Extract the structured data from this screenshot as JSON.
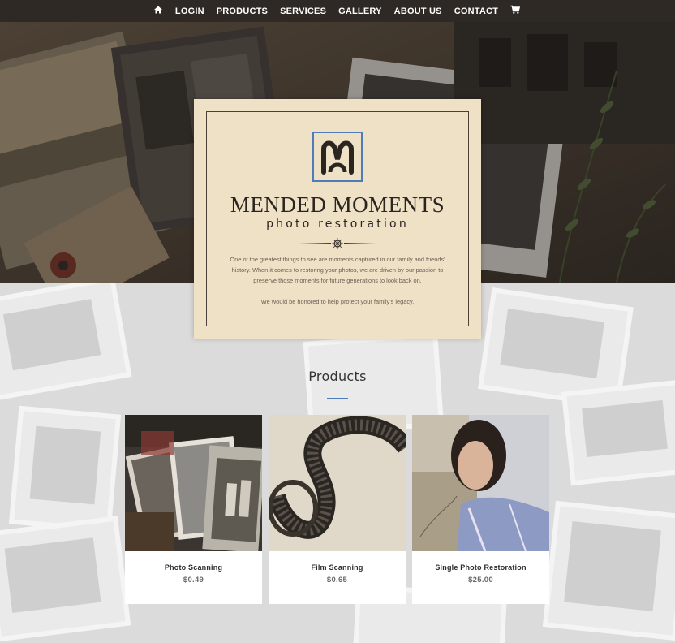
{
  "nav": {
    "home_icon": "home-icon",
    "items": [
      {
        "label": "LOGIN"
      },
      {
        "label": "PRODUCTS"
      },
      {
        "label": "SERVICES"
      },
      {
        "label": "GALLERY"
      },
      {
        "label": "ABOUT US"
      },
      {
        "label": "CONTACT"
      }
    ],
    "cart_icon": "cart-icon"
  },
  "hero_card": {
    "logo_icon": "mended-moments-monogram-icon",
    "title": "MENDED MOMENTS",
    "subtitle": "photo restoration",
    "paragraph_1": "One of the greatest things to see are moments captured in our family and friends' history. When it comes to restoring  your photos, we are driven by our passion to preserve those moments for future generations to look back on.",
    "paragraph_2": "We would be honored to help protect your family's legacy."
  },
  "products": {
    "heading": "Products",
    "items": [
      {
        "name": "Photo Scanning",
        "price": "$0.49"
      },
      {
        "name": "Film Scanning",
        "price": "$0.65"
      },
      {
        "name": "Single Photo Restoration",
        "price": "$25.00"
      }
    ]
  },
  "colors": {
    "nav_bg": "#2f2925",
    "card_bg": "#efe1c6",
    "accent_blue": "#4d7cb8",
    "text_dark": "#2b2520"
  }
}
